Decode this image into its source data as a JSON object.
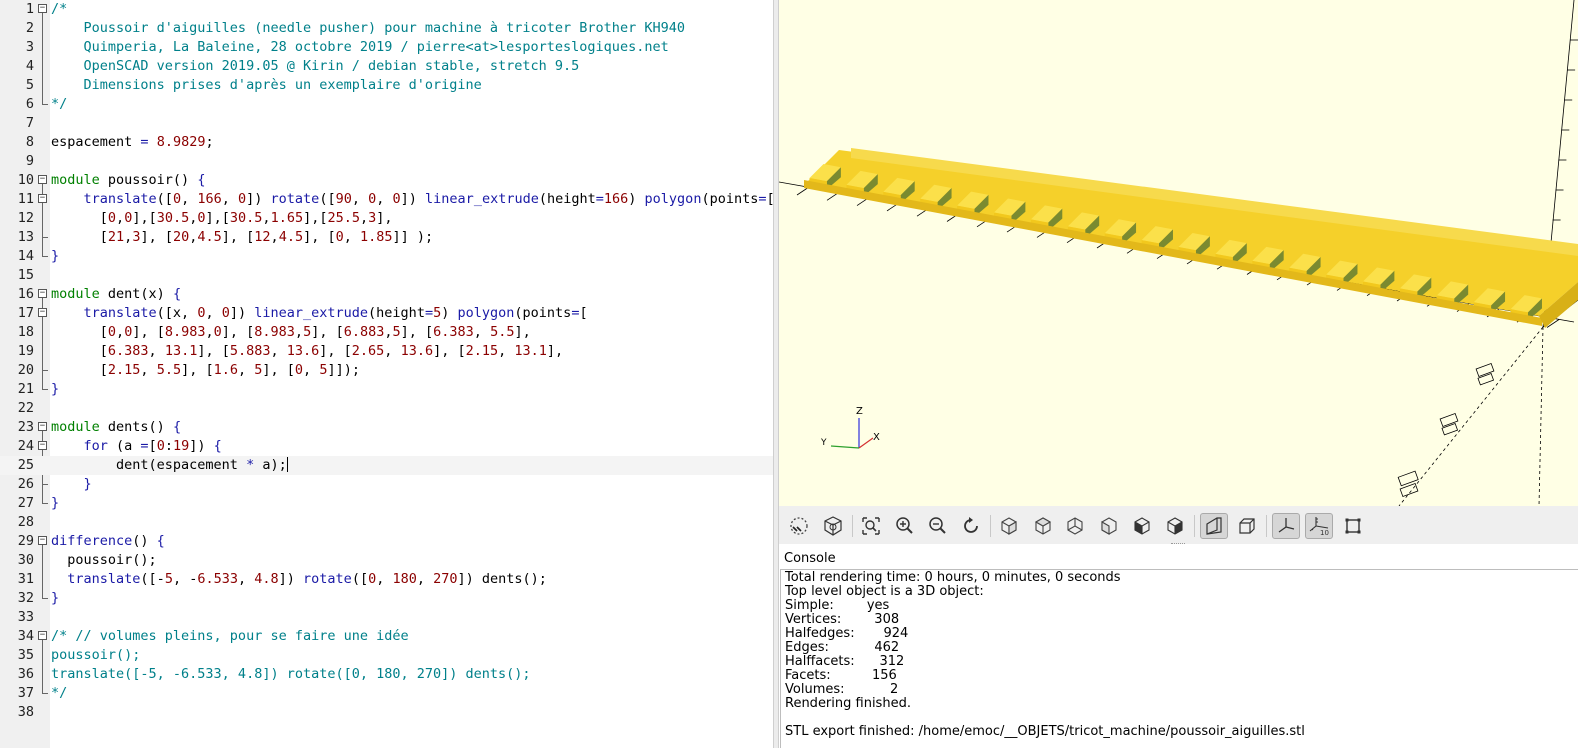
{
  "editor": {
    "current_line": 25,
    "lines": [
      {
        "n": "1",
        "tokens": [
          {
            "t": "cm",
            "v": "/*"
          }
        ]
      },
      {
        "n": "2",
        "tokens": [
          {
            "t": "cm",
            "v": "    Poussoir d'aiguilles (needle pusher) pour machine à tricoter Brother KH940"
          }
        ]
      },
      {
        "n": "3",
        "tokens": [
          {
            "t": "cm",
            "v": "    Quimperia, La Baleine, 28 octobre 2019 / pierre<at>lesporteslogiques.net"
          }
        ]
      },
      {
        "n": "4",
        "tokens": [
          {
            "t": "cm",
            "v": "    OpenSCAD version 2019.05 @ Kirin / debian stable, stretch 9.5"
          }
        ]
      },
      {
        "n": "5",
        "tokens": [
          {
            "t": "cm",
            "v": "    Dimensions prises d'après un exemplaire d'origine"
          }
        ]
      },
      {
        "n": "6",
        "tokens": [
          {
            "t": "cm",
            "v": "*/"
          }
        ]
      },
      {
        "n": "7",
        "tokens": []
      },
      {
        "n": "8",
        "tokens": [
          {
            "t": "",
            "v": "espacement "
          },
          {
            "t": "op",
            "v": "="
          },
          {
            "t": "",
            "v": " "
          },
          {
            "t": "num",
            "v": "8.9829"
          },
          {
            "t": "",
            "v": ";"
          }
        ]
      },
      {
        "n": "9",
        "tokens": []
      },
      {
        "n": "10",
        "tokens": [
          {
            "t": "kw",
            "v": "module"
          },
          {
            "t": "",
            "v": " poussoir() "
          },
          {
            "t": "op",
            "v": "{"
          }
        ]
      },
      {
        "n": "11",
        "tokens": [
          {
            "t": "",
            "v": "    "
          },
          {
            "t": "fn",
            "v": "translate"
          },
          {
            "t": "",
            "v": "(["
          },
          {
            "t": "num",
            "v": "0"
          },
          {
            "t": "",
            "v": ", "
          },
          {
            "t": "num",
            "v": "166"
          },
          {
            "t": "",
            "v": ", "
          },
          {
            "t": "num",
            "v": "0"
          },
          {
            "t": "",
            "v": "]) "
          },
          {
            "t": "fn",
            "v": "rotate"
          },
          {
            "t": "",
            "v": "(["
          },
          {
            "t": "num",
            "v": "90"
          },
          {
            "t": "",
            "v": ", "
          },
          {
            "t": "num",
            "v": "0"
          },
          {
            "t": "",
            "v": ", "
          },
          {
            "t": "num",
            "v": "0"
          },
          {
            "t": "",
            "v": "]) "
          },
          {
            "t": "fn",
            "v": "linear_extrude"
          },
          {
            "t": "",
            "v": "(height"
          },
          {
            "t": "op",
            "v": "="
          },
          {
            "t": "num",
            "v": "166"
          },
          {
            "t": "",
            "v": ") "
          },
          {
            "t": "fn",
            "v": "polygon"
          },
          {
            "t": "",
            "v": "(points"
          },
          {
            "t": "op",
            "v": "="
          },
          {
            "t": "",
            "v": "["
          }
        ]
      },
      {
        "n": "12",
        "tokens": [
          {
            "t": "",
            "v": "      ["
          },
          {
            "t": "num",
            "v": "0"
          },
          {
            "t": "",
            "v": ","
          },
          {
            "t": "num",
            "v": "0"
          },
          {
            "t": "",
            "v": "],["
          },
          {
            "t": "num",
            "v": "30.5"
          },
          {
            "t": "",
            "v": ","
          },
          {
            "t": "num",
            "v": "0"
          },
          {
            "t": "",
            "v": "],["
          },
          {
            "t": "num",
            "v": "30.5"
          },
          {
            "t": "",
            "v": ","
          },
          {
            "t": "num",
            "v": "1.65"
          },
          {
            "t": "",
            "v": "],["
          },
          {
            "t": "num",
            "v": "25.5"
          },
          {
            "t": "",
            "v": ","
          },
          {
            "t": "num",
            "v": "3"
          },
          {
            "t": "",
            "v": "],"
          }
        ]
      },
      {
        "n": "13",
        "tokens": [
          {
            "t": "",
            "v": "      ["
          },
          {
            "t": "num",
            "v": "21"
          },
          {
            "t": "",
            "v": ","
          },
          {
            "t": "num",
            "v": "3"
          },
          {
            "t": "",
            "v": "], ["
          },
          {
            "t": "num",
            "v": "20"
          },
          {
            "t": "",
            "v": ","
          },
          {
            "t": "num",
            "v": "4.5"
          },
          {
            "t": "",
            "v": "], ["
          },
          {
            "t": "num",
            "v": "12"
          },
          {
            "t": "",
            "v": ","
          },
          {
            "t": "num",
            "v": "4.5"
          },
          {
            "t": "",
            "v": "], ["
          },
          {
            "t": "num",
            "v": "0"
          },
          {
            "t": "",
            "v": ", "
          },
          {
            "t": "num",
            "v": "1.85"
          },
          {
            "t": "",
            "v": "]] );"
          }
        ]
      },
      {
        "n": "14",
        "tokens": [
          {
            "t": "op",
            "v": "}"
          }
        ]
      },
      {
        "n": "15",
        "tokens": []
      },
      {
        "n": "16",
        "tokens": [
          {
            "t": "kw",
            "v": "module"
          },
          {
            "t": "",
            "v": " dent(x) "
          },
          {
            "t": "op",
            "v": "{"
          }
        ]
      },
      {
        "n": "17",
        "tokens": [
          {
            "t": "",
            "v": "    "
          },
          {
            "t": "fn",
            "v": "translate"
          },
          {
            "t": "",
            "v": "([x, "
          },
          {
            "t": "num",
            "v": "0"
          },
          {
            "t": "",
            "v": ", "
          },
          {
            "t": "num",
            "v": "0"
          },
          {
            "t": "",
            "v": "]) "
          },
          {
            "t": "fn",
            "v": "linear_extrude"
          },
          {
            "t": "",
            "v": "(height"
          },
          {
            "t": "op",
            "v": "="
          },
          {
            "t": "num",
            "v": "5"
          },
          {
            "t": "",
            "v": ") "
          },
          {
            "t": "fn",
            "v": "polygon"
          },
          {
            "t": "",
            "v": "(points"
          },
          {
            "t": "op",
            "v": "="
          },
          {
            "t": "",
            "v": "["
          }
        ]
      },
      {
        "n": "18",
        "tokens": [
          {
            "t": "",
            "v": "      ["
          },
          {
            "t": "num",
            "v": "0"
          },
          {
            "t": "",
            "v": ","
          },
          {
            "t": "num",
            "v": "0"
          },
          {
            "t": "",
            "v": "], ["
          },
          {
            "t": "num",
            "v": "8.983"
          },
          {
            "t": "",
            "v": ","
          },
          {
            "t": "num",
            "v": "0"
          },
          {
            "t": "",
            "v": "], ["
          },
          {
            "t": "num",
            "v": "8.983"
          },
          {
            "t": "",
            "v": ","
          },
          {
            "t": "num",
            "v": "5"
          },
          {
            "t": "",
            "v": "], ["
          },
          {
            "t": "num",
            "v": "6.883"
          },
          {
            "t": "",
            "v": ","
          },
          {
            "t": "num",
            "v": "5"
          },
          {
            "t": "",
            "v": "], ["
          },
          {
            "t": "num",
            "v": "6.383"
          },
          {
            "t": "",
            "v": ", "
          },
          {
            "t": "num",
            "v": "5.5"
          },
          {
            "t": "",
            "v": "],"
          }
        ]
      },
      {
        "n": "19",
        "tokens": [
          {
            "t": "",
            "v": "      ["
          },
          {
            "t": "num",
            "v": "6.383"
          },
          {
            "t": "",
            "v": ", "
          },
          {
            "t": "num",
            "v": "13.1"
          },
          {
            "t": "",
            "v": "], ["
          },
          {
            "t": "num",
            "v": "5.883"
          },
          {
            "t": "",
            "v": ", "
          },
          {
            "t": "num",
            "v": "13.6"
          },
          {
            "t": "",
            "v": "], ["
          },
          {
            "t": "num",
            "v": "2.65"
          },
          {
            "t": "",
            "v": ", "
          },
          {
            "t": "num",
            "v": "13.6"
          },
          {
            "t": "",
            "v": "], ["
          },
          {
            "t": "num",
            "v": "2.15"
          },
          {
            "t": "",
            "v": ", "
          },
          {
            "t": "num",
            "v": "13.1"
          },
          {
            "t": "",
            "v": "],"
          }
        ]
      },
      {
        "n": "20",
        "tokens": [
          {
            "t": "",
            "v": "      ["
          },
          {
            "t": "num",
            "v": "2.15"
          },
          {
            "t": "",
            "v": ", "
          },
          {
            "t": "num",
            "v": "5.5"
          },
          {
            "t": "",
            "v": "], ["
          },
          {
            "t": "num",
            "v": "1.6"
          },
          {
            "t": "",
            "v": ", "
          },
          {
            "t": "num",
            "v": "5"
          },
          {
            "t": "",
            "v": "], ["
          },
          {
            "t": "num",
            "v": "0"
          },
          {
            "t": "",
            "v": ", "
          },
          {
            "t": "num",
            "v": "5"
          },
          {
            "t": "",
            "v": "]]);"
          }
        ]
      },
      {
        "n": "21",
        "tokens": [
          {
            "t": "op",
            "v": "}"
          }
        ]
      },
      {
        "n": "22",
        "tokens": []
      },
      {
        "n": "23",
        "tokens": [
          {
            "t": "kw",
            "v": "module"
          },
          {
            "t": "",
            "v": " dents() "
          },
          {
            "t": "op",
            "v": "{"
          }
        ]
      },
      {
        "n": "24",
        "tokens": [
          {
            "t": "",
            "v": "    "
          },
          {
            "t": "fn",
            "v": "for"
          },
          {
            "t": "",
            "v": " (a "
          },
          {
            "t": "op",
            "v": "="
          },
          {
            "t": "",
            "v": "["
          },
          {
            "t": "num",
            "v": "0"
          },
          {
            "t": "",
            "v": ":"
          },
          {
            "t": "num",
            "v": "19"
          },
          {
            "t": "",
            "v": "]) "
          },
          {
            "t": "op",
            "v": "{"
          }
        ]
      },
      {
        "n": "25",
        "tokens": [
          {
            "t": "",
            "v": "        dent(espacement "
          },
          {
            "t": "op",
            "v": "*"
          },
          {
            "t": "",
            "v": " a);"
          }
        ]
      },
      {
        "n": "26",
        "tokens": [
          {
            "t": "",
            "v": "    "
          },
          {
            "t": "op",
            "v": "}"
          }
        ]
      },
      {
        "n": "27",
        "tokens": [
          {
            "t": "op",
            "v": "}"
          }
        ]
      },
      {
        "n": "28",
        "tokens": []
      },
      {
        "n": "29",
        "tokens": [
          {
            "t": "fn",
            "v": "difference"
          },
          {
            "t": "",
            "v": "() "
          },
          {
            "t": "op",
            "v": "{"
          }
        ]
      },
      {
        "n": "30",
        "tokens": [
          {
            "t": "",
            "v": "  poussoir();"
          }
        ]
      },
      {
        "n": "31",
        "tokens": [
          {
            "t": "",
            "v": "  "
          },
          {
            "t": "fn",
            "v": "translate"
          },
          {
            "t": "",
            "v": "([-"
          },
          {
            "t": "num",
            "v": "5"
          },
          {
            "t": "",
            "v": ", -"
          },
          {
            "t": "num",
            "v": "6.533"
          },
          {
            "t": "",
            "v": ", "
          },
          {
            "t": "num",
            "v": "4.8"
          },
          {
            "t": "",
            "v": "]) "
          },
          {
            "t": "fn",
            "v": "rotate"
          },
          {
            "t": "",
            "v": "(["
          },
          {
            "t": "num",
            "v": "0"
          },
          {
            "t": "",
            "v": ", "
          },
          {
            "t": "num",
            "v": "180"
          },
          {
            "t": "",
            "v": ", "
          },
          {
            "t": "num",
            "v": "270"
          },
          {
            "t": "",
            "v": "]) dents();"
          }
        ]
      },
      {
        "n": "32",
        "tokens": [
          {
            "t": "op",
            "v": "}"
          }
        ]
      },
      {
        "n": "33",
        "tokens": []
      },
      {
        "n": "34",
        "tokens": [
          {
            "t": "cm",
            "v": "/* // volumes pleins, pour se faire une idée"
          }
        ]
      },
      {
        "n": "35",
        "tokens": [
          {
            "t": "cm",
            "v": "poussoir();"
          }
        ]
      },
      {
        "n": "36",
        "tokens": [
          {
            "t": "cm",
            "v": "translate([-5, -6.533, 4.8]) rotate([0, 180, 270]) dents();"
          }
        ]
      },
      {
        "n": "37",
        "tokens": [
          {
            "t": "cm",
            "v": "*/"
          }
        ]
      },
      {
        "n": "38",
        "tokens": []
      }
    ]
  },
  "viewport": {
    "background": "#ffffe5",
    "model_top": "#f5d02a",
    "model_front": "#f2c81d",
    "model_teeth_side": "#7a8a30",
    "axis_labels": {
      "z": "Z",
      "y": "Y",
      "x": "X"
    },
    "teeth_count": 20
  },
  "toolbar": {
    "buttons": [
      {
        "name": "preview-icon",
        "title": "Preview"
      },
      {
        "name": "render-icon",
        "title": "Render"
      },
      {
        "name": "view-all-icon",
        "title": "View All"
      },
      {
        "name": "zoom-in-icon",
        "title": "Zoom In"
      },
      {
        "name": "zoom-out-icon",
        "title": "Zoom Out"
      },
      {
        "name": "reset-view-icon",
        "title": "Reset View"
      },
      {
        "name": "view-right-icon",
        "title": "Right"
      },
      {
        "name": "view-top-icon",
        "title": "Top"
      },
      {
        "name": "view-bottom-icon",
        "title": "Bottom"
      },
      {
        "name": "view-left-icon",
        "title": "Left"
      },
      {
        "name": "view-front-icon",
        "title": "Front"
      },
      {
        "name": "view-back-icon",
        "title": "Back"
      },
      {
        "name": "perspective-icon",
        "title": "Perspective"
      },
      {
        "name": "orthogonal-icon",
        "title": "Orthogonal"
      },
      {
        "name": "show-axes-icon",
        "title": "Show Axes"
      },
      {
        "name": "show-scale-markers-icon",
        "title": "Show Scale Markers"
      },
      {
        "name": "show-edges-icon",
        "title": "Show Edges"
      }
    ]
  },
  "console": {
    "label": "Console",
    "lines": [
      "Total rendering time: 0 hours, 0 minutes, 0 seconds",
      "Top level object is a 3D object:",
      "Simple:        yes",
      "Vertices:        308",
      "Halfedges:       924",
      "Edges:           462",
      "Halffacets:      312",
      "Facets:          156",
      "Volumes:           2",
      "Rendering finished.",
      "",
      "STL export finished: /home/emoc/__OBJETS/tricot_machine/poussoir_aiguilles.stl"
    ]
  }
}
